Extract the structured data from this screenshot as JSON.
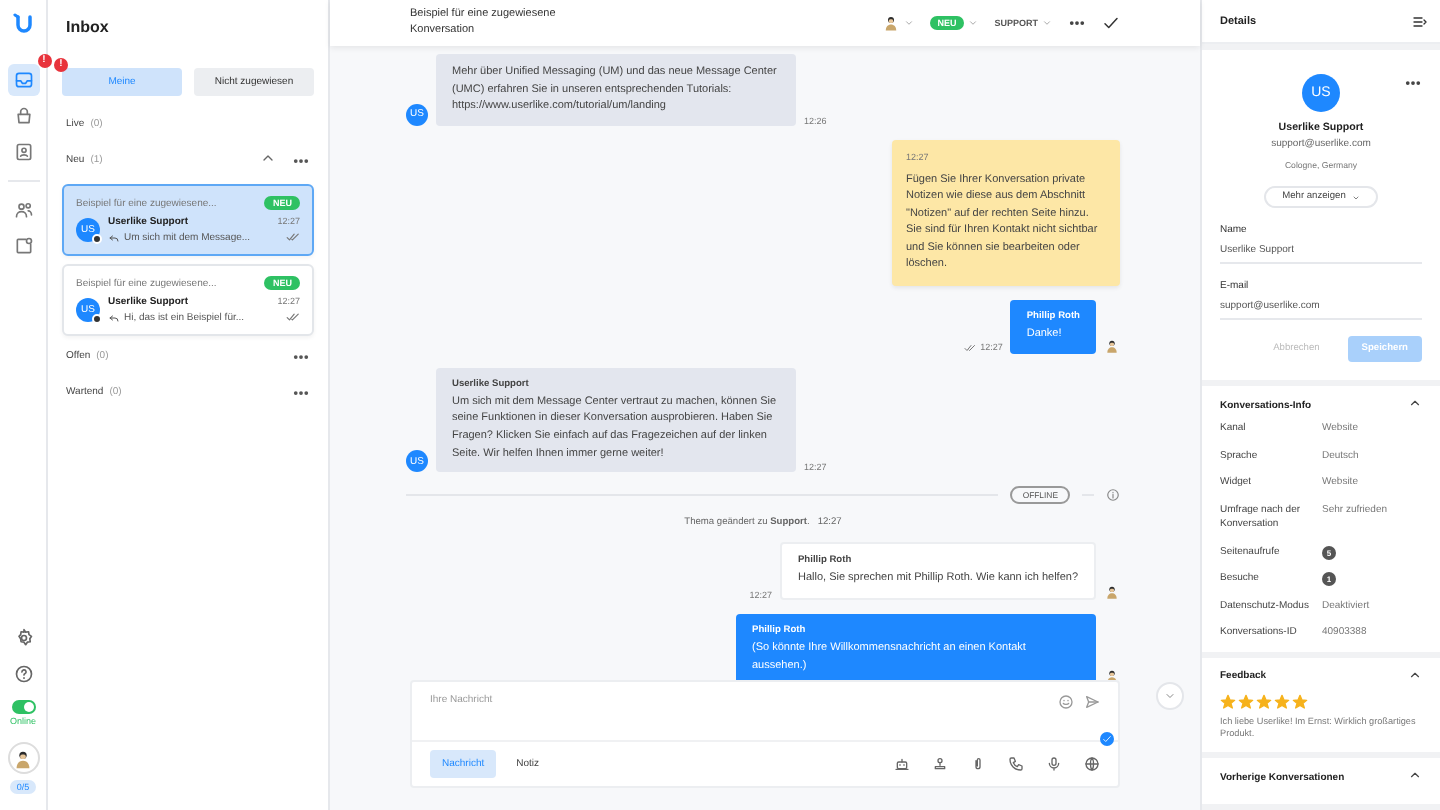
{
  "nav": {
    "items": [
      {
        "kind": "inbox",
        "selected": true,
        "badge": "!"
      },
      {
        "kind": "bag",
        "selected": false
      },
      {
        "kind": "book",
        "selected": false
      },
      {
        "kind": "people",
        "selected": false
      },
      {
        "kind": "widget",
        "selected": false
      }
    ],
    "bottom": [
      {
        "kind": "settings"
      },
      {
        "kind": "help"
      }
    ],
    "status": {
      "on": true,
      "label": "Online"
    },
    "capacity": "0/5"
  },
  "inbox": {
    "title": "Inbox",
    "filters": [
      {
        "label": "Meine",
        "selected": true,
        "badge": "!"
      },
      {
        "label": "Nicht zugewiesen",
        "selected": false
      }
    ],
    "sections": [
      {
        "name": "Live",
        "count": "(0)",
        "menu": false
      },
      {
        "name": "Neu",
        "count": "(1)",
        "menu": true,
        "expanded": true,
        "conversations": [
          {
            "subject": "Beispiel für eine zugewiesene...",
            "badge": "NEU",
            "avatar": "US",
            "name": "Userlike Support",
            "time": "12:27",
            "preview": "Um sich mit dem Message...",
            "selected": true
          },
          {
            "subject": "Beispiel für eine zugewiesene...",
            "badge": "NEU",
            "avatar": "US",
            "name": "Userlike Support",
            "time": "12:27",
            "preview": "Hi, das ist ein Beispiel für...",
            "selected": false
          }
        ]
      },
      {
        "name": "Offen",
        "count": "(0)",
        "menu": true
      },
      {
        "name": "Wartend",
        "count": "(0)",
        "menu": true
      }
    ]
  },
  "chat": {
    "header": {
      "title": "Beispiel für eine zugewiesene Konversation",
      "status": "NEU",
      "topic": "SUPPORT"
    },
    "messages": [
      {
        "kind": "contact",
        "avatar": "US",
        "text": "Mehr über Unified Messaging (UM) und das neue Message Center (UMC) erfahren Sie in unseren entsprechenden Tutorials: https://www.userlike.com/tutorial/um/landing",
        "time": "12:26"
      },
      {
        "kind": "note",
        "time": "12:27",
        "text": "Fügen Sie Ihrer Konversation private Notizen wie diese aus dem Abschnitt \"Notizen\" auf der rechten Seite hinzu. Sie sind für Ihren Kontakt nicht sichtbar und Sie können sie bearbeiten oder löschen."
      },
      {
        "kind": "agent",
        "sender": "Phillip Roth",
        "text": "Danke!",
        "time": "12:27",
        "read": true
      },
      {
        "kind": "contact",
        "avatar": "US",
        "sender": "Userlike Support",
        "text": "Um sich mit dem Message Center vertraut zu machen, können Sie seine Funktionen in dieser Konversation ausprobieren. Haben Sie Fragen? Klicken Sie einfach auf das Fragezeichen auf der linken Seite. Wir helfen Ihnen immer gerne weiter!",
        "time": "12:27"
      },
      {
        "kind": "divider",
        "label": "OFFLINE"
      },
      {
        "kind": "event",
        "text": "Thema geändert zu **Support**.",
        "time": "12:27"
      },
      {
        "kind": "greeting",
        "sender": "Phillip Roth",
        "text": "Hallo, Sie sprechen mit Phillip Roth. Wie kann ich helfen?",
        "time": "12:27"
      },
      {
        "kind": "agent",
        "sender": "Phillip Roth",
        "text": "(So könnte Ihre Willkommensnachricht an einen Kontakt aussehen.)"
      }
    ],
    "composer": {
      "placeholder": "Ihre Nachricht",
      "modes": [
        {
          "label": "Nachricht",
          "selected": true
        },
        {
          "label": "Notiz",
          "selected": false
        }
      ]
    }
  },
  "details": {
    "title": "Details",
    "contact": {
      "avatar": "US",
      "name": "Userlike Support",
      "email": "support@userlike.com",
      "location": "Cologne, Germany"
    },
    "more": "Mehr anzeigen",
    "fields": [
      {
        "label": "Name",
        "value": "Userlike Support"
      },
      {
        "label": "E-mail",
        "value": "support@userlike.com"
      }
    ],
    "actions": [
      {
        "label": "Abbrechen",
        "kind": "text",
        "disabled": true
      },
      {
        "label": "Speichern",
        "kind": "primary",
        "disabled": true
      }
    ],
    "sections": [
      {
        "kind": "info",
        "title": "Konversations-Info",
        "expanded": true,
        "rows": [
          {
            "label": "Kanal",
            "value": "Website",
            "kind": "text"
          },
          {
            "label": "Sprache",
            "value": "Deutsch",
            "kind": "text"
          },
          {
            "label": "Widget",
            "value": "Website",
            "kind": "text"
          },
          {
            "label": "Umfrage nach der Konversation",
            "value": "Sehr zufrieden",
            "kind": "text"
          },
          {
            "label": "Seitenaufrufe",
            "value": "5",
            "kind": "count"
          },
          {
            "label": "Besuche",
            "value": "1",
            "kind": "count"
          },
          {
            "label": "Datenschutz-Modus",
            "value": "Deaktiviert",
            "kind": "text"
          },
          {
            "label": "Konversations-ID",
            "value": "40903388",
            "kind": "text"
          }
        ]
      },
      {
        "kind": "feedback",
        "title": "Feedback",
        "expanded": true,
        "stars": 5,
        "comment": "Ich liebe Userlike! Im Ernst: Wirklich großartiges Produkt."
      },
      {
        "kind": "list",
        "title": "Vorherige Konversationen",
        "expanded": true
      }
    ]
  }
}
